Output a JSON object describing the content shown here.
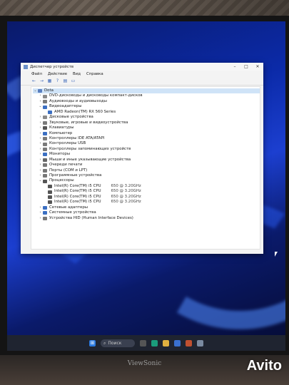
{
  "window": {
    "title": "Диспетчер устройств",
    "controls": [
      "–",
      "□",
      "✕"
    ]
  },
  "menu": [
    "Файл",
    "Действие",
    "Вид",
    "Справка"
  ],
  "toolbar_icons": [
    "back-icon",
    "forward-icon",
    "properties-icon",
    "help-icon",
    "print-icon",
    "monitor-icon"
  ],
  "tree": {
    "root": "Dota",
    "nodes": [
      {
        "label": "DVD-дисководы и дисководы компакт-дисков",
        "level": 1,
        "chev": "›",
        "color": "#8a8a8a"
      },
      {
        "label": "Аудиовходы и аудиовыходы",
        "level": 1,
        "chev": "›",
        "color": "#7a7a7a"
      },
      {
        "label": "Видеоадаптеры",
        "level": 1,
        "chev": "⌄",
        "color": "#3b6fc2"
      },
      {
        "label": "AMD Radeon(TM) RX 560 Series",
        "level": 2,
        "chev": "",
        "color": "#3b6fc2"
      },
      {
        "label": "Дисковые устройства",
        "level": 1,
        "chev": "›",
        "color": "#8a8a8a"
      },
      {
        "label": "Звуковые, игровые и видеоустройства",
        "level": 1,
        "chev": "›",
        "color": "#7a7a7a"
      },
      {
        "label": "Клавиатуры",
        "level": 1,
        "chev": "›",
        "color": "#555"
      },
      {
        "label": "Компьютер",
        "level": 1,
        "chev": "›",
        "color": "#3b6fc2"
      },
      {
        "label": "Контроллеры IDE ATA/ATAPI",
        "level": 1,
        "chev": "›",
        "color": "#7a7a7a"
      },
      {
        "label": "Контроллеры USB",
        "level": 1,
        "chev": "›",
        "color": "#7a7a7a"
      },
      {
        "label": "Контроллеры запоминающих устройств",
        "level": 1,
        "chev": "›",
        "color": "#7a7a7a"
      },
      {
        "label": "Мониторы",
        "level": 1,
        "chev": "›",
        "color": "#3b6fc2"
      },
      {
        "label": "Мыши и иные указывающие устройства",
        "level": 1,
        "chev": "›",
        "color": "#666"
      },
      {
        "label": "Очереди печати",
        "level": 1,
        "chev": "›",
        "color": "#777"
      },
      {
        "label": "Порты (COM и LPT)",
        "level": 1,
        "chev": "›",
        "color": "#777"
      },
      {
        "label": "Программные устройства",
        "level": 1,
        "chev": "›",
        "color": "#777"
      },
      {
        "label": "Процессоры",
        "level": 1,
        "chev": "⌄",
        "color": "#555"
      },
      {
        "label": "Intel(R) Core(TM) i5 CPU",
        "speed": "650 @ 3.20GHz",
        "level": 2,
        "chev": "",
        "color": "#555"
      },
      {
        "label": "Intel(R) Core(TM) i5 CPU",
        "speed": "650 @ 3.20GHz",
        "level": 2,
        "chev": "",
        "color": "#555"
      },
      {
        "label": "Intel(R) Core(TM) i5 CPU",
        "speed": "650 @ 3.20GHz",
        "level": 2,
        "chev": "",
        "color": "#555"
      },
      {
        "label": "Intel(R) Core(TM) i5 CPU",
        "speed": "650 @ 3.20GHz",
        "level": 2,
        "chev": "",
        "color": "#555"
      },
      {
        "label": "Сетевые адаптеры",
        "level": 1,
        "chev": "›",
        "color": "#3b6fc2"
      },
      {
        "label": "Системные устройства",
        "level": 1,
        "chev": "›",
        "color": "#3b6fc2"
      },
      {
        "label": "Устройства HID (Human Interface Devices)",
        "level": 1,
        "chev": "›",
        "color": "#777"
      }
    ]
  },
  "taskbar": {
    "search_label": "Поиск",
    "icons": [
      "start-icon",
      "task-view-icon",
      "edge-icon",
      "explorer-icon",
      "store-icon",
      "app-icon",
      "device-manager-icon"
    ]
  },
  "monitor_brand": "ViewSonic",
  "watermark": "Avito"
}
